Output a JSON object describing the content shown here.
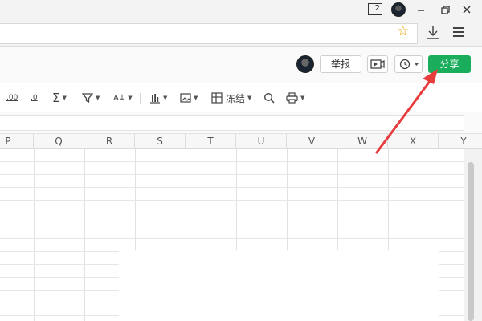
{
  "window": {
    "tab_count": "2"
  },
  "header": {
    "report_label": "举报",
    "share_label": "分享"
  },
  "toolbar": {
    "freeze_label": "冻结",
    "decimal_add": ".00",
    "decimal_remove": ".0",
    "sort_label": "A↓"
  },
  "grid": {
    "columns": [
      "P",
      "Q",
      "R",
      "S",
      "T",
      "U",
      "V",
      "W",
      "X",
      "Y"
    ]
  },
  "colors": {
    "share_button": "#1aad5c",
    "annotation_arrow": "#e83c3c",
    "star": "#e6a400"
  },
  "icons": [
    "star-icon",
    "download-icon",
    "menu-icon",
    "video-icon",
    "history-icon",
    "sum-icon",
    "filter-icon",
    "sort-icon",
    "chart-icon",
    "image-icon",
    "freeze-icon",
    "search-icon",
    "print-icon"
  ]
}
